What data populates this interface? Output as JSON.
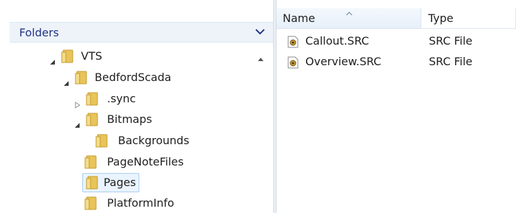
{
  "nav": {
    "header_label": "Folders",
    "tree": [
      {
        "label": "VTS",
        "expanded": true
      },
      {
        "label": "BedfordScada",
        "expanded": true
      },
      {
        "label": ".sync",
        "expanded": false
      },
      {
        "label": "Bitmaps",
        "expanded": true
      },
      {
        "label": "Backgrounds"
      },
      {
        "label": "PageNoteFiles"
      },
      {
        "label": "Pages",
        "selected": true
      },
      {
        "label": "PlatformInfo"
      }
    ]
  },
  "list": {
    "columns": {
      "name": "Name",
      "type": "Type"
    },
    "files": [
      {
        "name": "Callout.SRC",
        "type": "SRC File"
      },
      {
        "name": "Overview.SRC",
        "type": "SRC File"
      }
    ]
  },
  "colors": {
    "folder_header_text": "#1e3287",
    "selection_fill": "#eaf4fe",
    "selection_border": "#a8cdef",
    "folder_yellow": "#e8c45a"
  }
}
